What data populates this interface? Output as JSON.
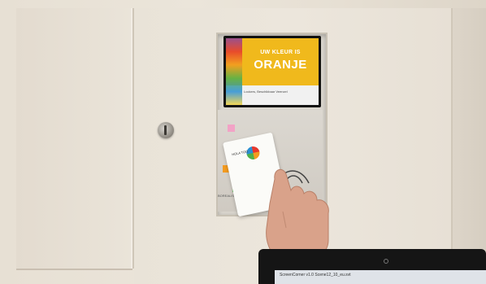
{
  "screen": {
    "line1": "UW KLEUR IS",
    "line2": "ORANJE",
    "footer": "Lockers, Beschikbaar Veenzel"
  },
  "card": {
    "text": "HOLA TOO"
  },
  "reader": {
    "label": "BOREALIS"
  },
  "laptop": {
    "window_title": "ScreenCorner v1.0 Scene12_10_eu.svt"
  },
  "colors": {
    "screen_accent": "#f0b91c",
    "wall": "#e9e3d8"
  }
}
